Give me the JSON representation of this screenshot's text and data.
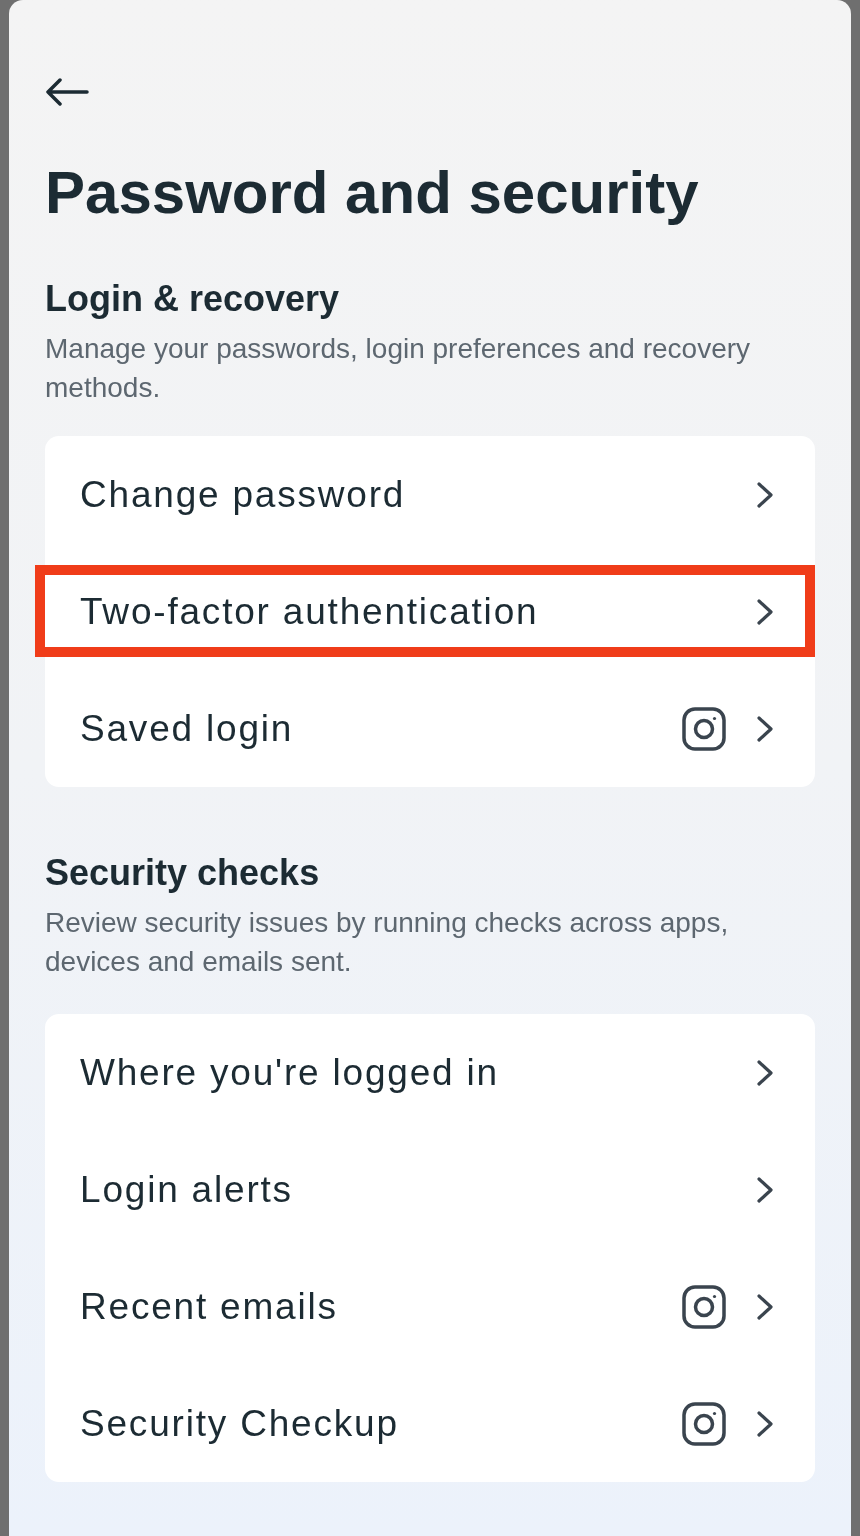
{
  "header": {
    "title": "Password and security"
  },
  "sections": [
    {
      "heading": "Login & recovery",
      "description": "Manage your passwords, login preferences and recovery methods.",
      "items": [
        {
          "label": "Change password",
          "app_icon": false,
          "highlighted": false
        },
        {
          "label": "Two-factor authentication",
          "app_icon": false,
          "highlighted": true
        },
        {
          "label": "Saved login",
          "app_icon": true,
          "highlighted": false
        }
      ]
    },
    {
      "heading": "Security checks",
      "description": "Review security issues by running checks across apps, devices and emails sent.",
      "items": [
        {
          "label": "Where you're logged in",
          "app_icon": false,
          "highlighted": false
        },
        {
          "label": "Login alerts",
          "app_icon": false,
          "highlighted": false
        },
        {
          "label": "Recent emails",
          "app_icon": true,
          "highlighted": false
        },
        {
          "label": "Security Checkup",
          "app_icon": true,
          "highlighted": false
        }
      ]
    }
  ]
}
